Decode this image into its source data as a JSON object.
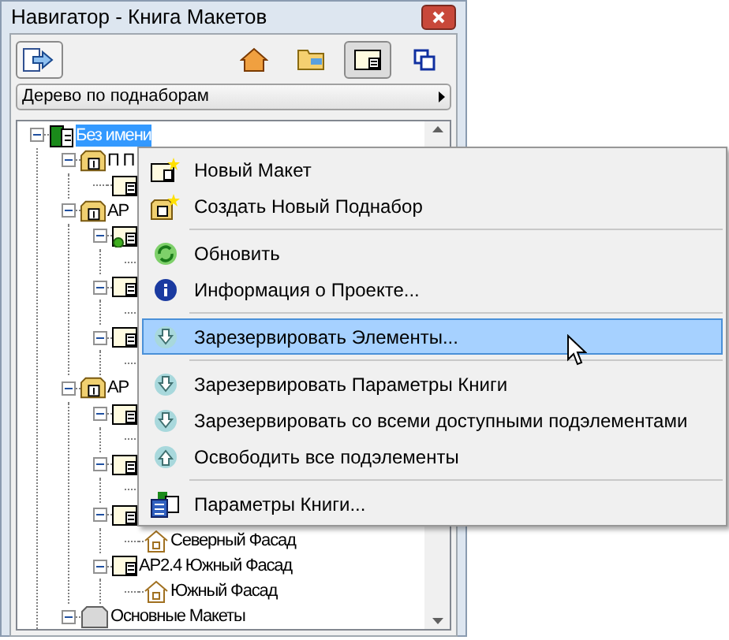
{
  "window": {
    "title": "Навигатор - Книга Макетов"
  },
  "toolbar": {
    "view_buttons": [
      {
        "kind": "model",
        "selected": false
      },
      {
        "kind": "folder",
        "selected": false
      },
      {
        "kind": "layout",
        "selected": true
      },
      {
        "kind": "clone",
        "selected": false
      }
    ]
  },
  "view_selector": {
    "value": "Дерево по поднаборам"
  },
  "tree": [
    {
      "kind": "book",
      "label": "Без имени",
      "selected": true,
      "expanded": true,
      "children": [
        {
          "kind": "subset",
          "label": "П П",
          "expanded": true,
          "children": [
            {
              "kind": "layout"
            }
          ]
        },
        {
          "kind": "subset",
          "label": "АР",
          "expanded": true,
          "children": [
            {
              "kind": "layout-live",
              "expanded": true,
              "children": [
                {
                  "kind": "view"
                }
              ]
            },
            {
              "kind": "layout",
              "expanded": true,
              "children": [
                {
                  "kind": "view"
                }
              ]
            },
            {
              "kind": "layout",
              "expanded": true,
              "children": [
                {
                  "kind": "view"
                }
              ]
            }
          ]
        },
        {
          "kind": "subset",
          "label": "АР",
          "expanded": true,
          "children": [
            {
              "kind": "layout",
              "expanded": true,
              "children": [
                {
                  "kind": "view"
                }
              ]
            },
            {
              "kind": "layout",
              "expanded": true,
              "children": [
                {
                  "kind": "view"
                }
              ]
            },
            {
              "kind": "layout",
              "expanded": true,
              "children": [
                {
                  "kind": "view",
                  "label": "Северный Фасад"
                }
              ]
            },
            {
              "kind": "layout",
              "label": "АР2.4 Южный Фасад",
              "expanded": true,
              "children": [
                {
                  "kind": "view",
                  "label": "Южный Фасад"
                }
              ]
            }
          ]
        },
        {
          "kind": "master",
          "label": "Основные Макеты",
          "expanded": true
        }
      ]
    }
  ],
  "context_menu": [
    {
      "kind": "new-layout",
      "label": "Новый Макет",
      "selected": false
    },
    {
      "kind": "new-subset",
      "label": "Создать Новый Поднабор",
      "selected": false
    },
    {
      "kind": "separator"
    },
    {
      "kind": "refresh",
      "label": "Обновить",
      "selected": false
    },
    {
      "kind": "info",
      "label": "Информация о Проекте...",
      "selected": false
    },
    {
      "kind": "separator"
    },
    {
      "kind": "reserve",
      "label": "Зарезервировать Элементы...",
      "selected": true
    },
    {
      "kind": "separator"
    },
    {
      "kind": "reserve",
      "label": "Зарезервировать Параметры Книги",
      "selected": false
    },
    {
      "kind": "reserve",
      "label": "Зарезервировать со всеми доступными подэлементами",
      "selected": false
    },
    {
      "kind": "release",
      "label": "Освободить все подэлементы",
      "selected": false
    },
    {
      "kind": "separator"
    },
    {
      "kind": "book-settings",
      "label": "Параметры Книги...",
      "selected": false
    }
  ]
}
